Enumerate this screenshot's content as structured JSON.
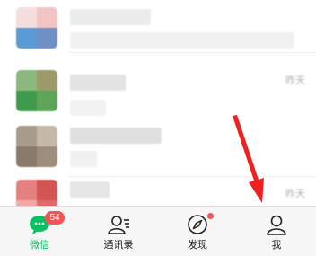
{
  "chat_list": {
    "rows": [
      {
        "time": "",
        "avatar_colors": [
          "#f6d7d7",
          "#e8a9a9",
          "#5b9bd5",
          "#6f8fc7",
          "#e9e9e9"
        ]
      },
      {
        "time": "昨天",
        "avatar_colors": [
          "#8ab87e",
          "#5ea55a",
          "#3f9b4d",
          "#9ccf8e",
          "#b8b09a"
        ]
      },
      {
        "time": "",
        "avatar_colors": [
          "#a79b8c",
          "#8a7a6b",
          "#c6b8a8",
          "#d3c9bd",
          "#9e8d7c"
        ]
      },
      {
        "time": "昨天",
        "avatar_colors": [
          "#e58080",
          "#d45454",
          "#f0a8a8",
          "#e06b6b",
          "#f5c4c4"
        ]
      }
    ]
  },
  "tabbar": {
    "tabs": [
      {
        "label": "微信",
        "icon": "chat-bubble-icon",
        "badge": "54",
        "active": true
      },
      {
        "label": "通讯录",
        "icon": "contacts-icon",
        "active": false
      },
      {
        "label": "发现",
        "icon": "compass-icon",
        "has_dot": true,
        "active": false
      },
      {
        "label": "我",
        "icon": "person-icon",
        "active": false
      }
    ]
  },
  "colors": {
    "accent": "#07c160",
    "badge": "#fa5151",
    "arrow": "#f02020"
  }
}
